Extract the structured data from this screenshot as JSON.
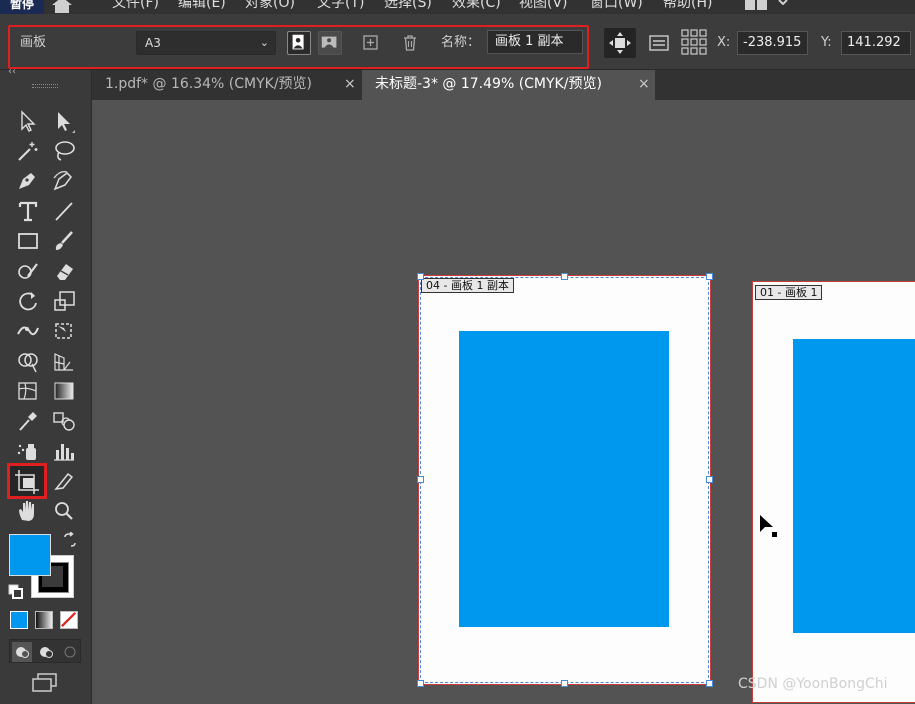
{
  "menu": {
    "app_logo": "暂停",
    "items": [
      "文件(F)",
      "编辑(E)",
      "对象(O)",
      "文字(T)",
      "选择(S)",
      "效果(C)",
      "视图(V)",
      "窗口(W)",
      "帮助(H)"
    ]
  },
  "control": {
    "panel_label": "画板",
    "preset": "A3",
    "name_label": "名称：",
    "name_value": "画板 1 副本",
    "x_label": "X:",
    "x_value": "-238.915",
    "y_label": "Y:",
    "y_value": "141.292"
  },
  "tabs": [
    {
      "label": "1.pdf* @ 16.34% (CMYK/预览)",
      "close": "×",
      "active": false
    },
    {
      "label": "未标题-3* @ 17.49% (CMYK/预览)",
      "close": "×",
      "active": true
    }
  ],
  "toolbar": {
    "collapse": "‹‹",
    "active_tool": "artboard-tool"
  },
  "colors": {
    "fill": "#0098ee",
    "stroke": "#000000",
    "highlight": "#e02020"
  },
  "canvas": {
    "artboards": [
      {
        "label": "04 - 画板 1 副本",
        "selected": true
      },
      {
        "label": "01 - 画板 1",
        "selected": false
      }
    ],
    "watermark": "CSDN @YoonBongChi"
  }
}
